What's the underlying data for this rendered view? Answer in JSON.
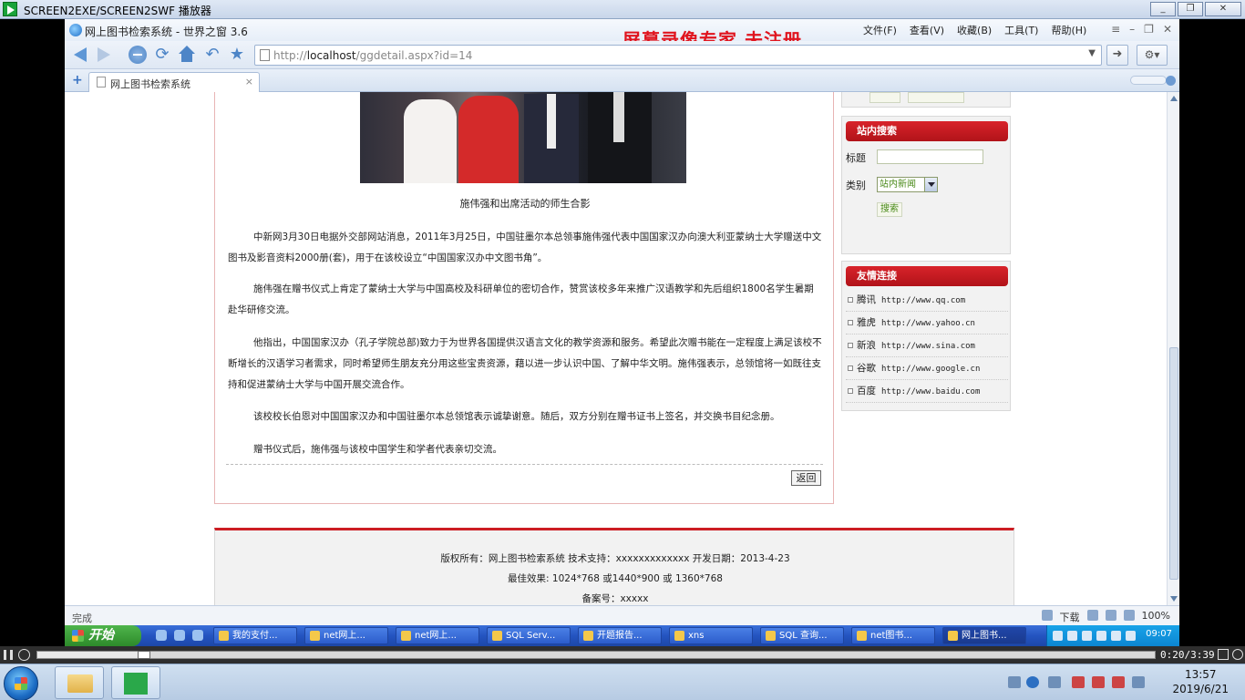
{
  "player": {
    "title": "SCREEN2EXE/SCREEN2SWF 播放器",
    "minimize": "_",
    "maximize": "❐",
    "close": "✕",
    "time": "0:20/3:39",
    "progress": 0.09
  },
  "browser": {
    "title": "网上图书检索系统 - 世界之窗 3.6",
    "watermark": "屏幕录像专家  未注册",
    "menu": [
      "文件(F)",
      "查看(V)",
      "收藏(B)",
      "工具(T)",
      "帮助(H)"
    ],
    "url_prefix": "http://",
    "url_host": "localhost",
    "url_path": "/ggdetail.aspx?id=14",
    "tab_label": "网上图书检索系统",
    "tab_close": "×",
    "status_left": "完成",
    "status_download": "下载",
    "zoom": "100%"
  },
  "article": {
    "caption": "施伟强和出席活动的师生合影",
    "paragraphs": [
      "中新网3月30日电据外交部网站消息，2011年3月25日，中国驻墨尔本总领事施伟强代表中国国家汉办向澳大利亚蒙纳士大学赠送中文图书及影音资料2000册(套)，用于在该校设立“中国国家汉办中文图书角”。",
      "施伟强在赠书仪式上肯定了蒙纳士大学与中国高校及科研单位的密切合作，赞赏该校多年来推广汉语教学和先后组织1800名学生暑期赴华研修交流。",
      "他指出，中国国家汉办（孔子学院总部)致力于为世界各国提供汉语言文化的教学资源和服务。希望此次赠书能在一定程度上满足该校不断增长的汉语学习者需求，同时希望师生朋友充分用这些宝贵资源，藉以进一步认识中国、了解中华文明。施伟强表示，总领馆将一如既往支持和促进蒙纳士大学与中国开展交流合作。",
      "该校校长伯恩对中国国家汉办和中国驻墨尔本总领馆表示诚挚谢意。随后，双方分别在赠书证书上签名，并交换书目纪念册。",
      "赠书仪式后，施伟强与该校中国学生和学者代表亲切交流。"
    ],
    "back_label": "返回"
  },
  "sidebar": {
    "search_title": "站内搜索",
    "title_label": "标题",
    "title_value": "",
    "category_label": "类别",
    "category_value": "站内新闻",
    "search_button": "搜索",
    "links_title": "友情连接",
    "links": [
      {
        "name": "腾讯",
        "url": "http://www.qq.com"
      },
      {
        "name": "雅虎",
        "url": "http://www.yahoo.cn"
      },
      {
        "name": "新浪",
        "url": "http://www.sina.com"
      },
      {
        "name": "谷歌",
        "url": "http://www.google.cn"
      },
      {
        "name": "百度",
        "url": "http://www.baidu.com"
      }
    ]
  },
  "footer": {
    "line1": "版权所有：网上图书检索系统 技术支持：xxxxxxxxxxxxx 开发日期：2013-4-23",
    "line2": "最佳效果: 1024*768 或1440*900 或 1360*768",
    "line3": "备案号：xxxxx"
  },
  "xp_taskbar": {
    "start": "开始",
    "items": [
      "我的支付...",
      "net网上...",
      "net网上...",
      "SQL Serv...",
      "开题报告...",
      "xns",
      "SQL 查询...",
      "net图书...",
      "网上图书..."
    ],
    "clock": "09:07"
  },
  "win7_taskbar": {
    "time": "13:57",
    "date": "2019/6/21"
  }
}
